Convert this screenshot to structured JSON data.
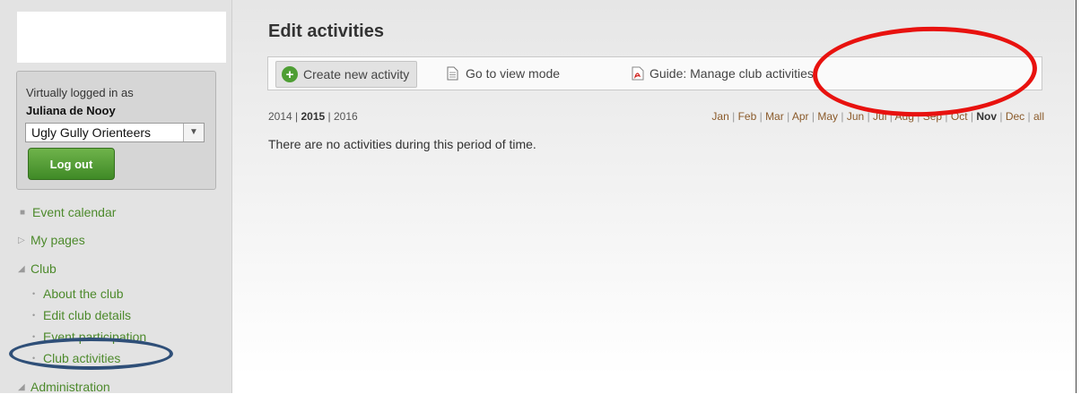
{
  "sidebar": {
    "login": {
      "caption": "Virtually logged in as",
      "user": "Juliana de Nooy",
      "club": "Ugly Gully Orienteers",
      "logout_label": "Log out"
    },
    "nav": {
      "event_calendar": "Event calendar",
      "my_pages": "My pages",
      "club": "Club",
      "about_club": "About the club",
      "edit_club_details": "Edit club details",
      "event_participation": "Event participation",
      "club_activities": "Club activities",
      "administration": "Administration"
    }
  },
  "main": {
    "title": "Edit activities",
    "toolbar": {
      "create": "Create new activity",
      "view_mode": "Go to view mode",
      "guide": "Guide: Manage club activities"
    },
    "years": [
      "2014",
      "2015",
      "2016"
    ],
    "months": [
      "Jan",
      "Feb",
      "Mar",
      "Apr",
      "May",
      "Jun",
      "Jul",
      "Aug",
      "Sep",
      "Oct",
      "Nov",
      "Dec",
      "all"
    ],
    "selected_year": "2015",
    "selected_month": "Nov",
    "empty_message": "There are no activities during this period of time."
  },
  "colors": {
    "link_green": "#4d8a2c",
    "logout_green": "#4a9a2c",
    "annotation_red": "#e8120f",
    "annotation_blue": "#2f4f78"
  }
}
